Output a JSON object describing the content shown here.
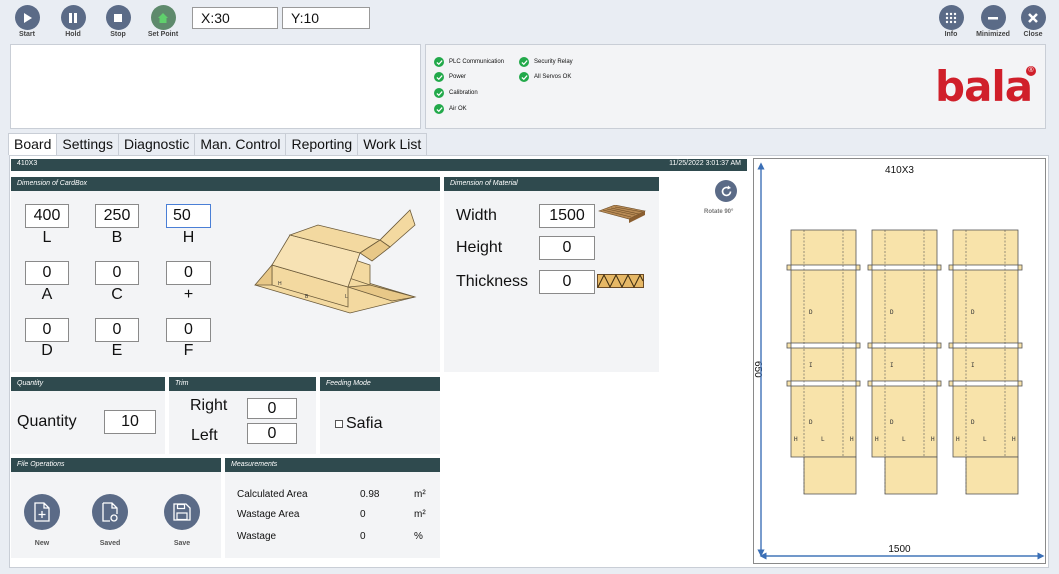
{
  "toolbar": {
    "start": "Start",
    "hold": "Hold",
    "stop": "Stop",
    "set_point": "Set Point",
    "x_coord": "X:30",
    "y_coord": "Y:10",
    "info": "Info",
    "minimized": "Minimized",
    "close": "Close"
  },
  "status": {
    "plc": "PLC Communication",
    "power": "Power",
    "calibration": "Calibration",
    "air": "Air OK",
    "security": "Security Relay",
    "servos": "All Servos OK"
  },
  "logo": {
    "text": "bala",
    "reg": "®"
  },
  "tabs": [
    "Board",
    "Settings",
    "Diagnostic",
    "Man. Control",
    "Reporting",
    "Work List"
  ],
  "board": {
    "name": "410X3",
    "datetime": "11/25/2022 3:01:37 AM",
    "cardbox_header": "Dimension of CardBox",
    "material_header": "Dimension of Material",
    "fields": {
      "L": "400",
      "B": "250",
      "H": "50",
      "A": "0",
      "C": "0",
      "plus": "0",
      "D": "0",
      "E": "0",
      "F": "0"
    },
    "labels": {
      "L": "L",
      "B": "B",
      "H": "H",
      "A": "A",
      "C": "C",
      "plus": "+",
      "D": "D",
      "E": "E",
      "F": "F"
    },
    "box_letters": {
      "h": "H",
      "b": "B",
      "l": "L"
    },
    "material": {
      "width_label": "Width",
      "width": "1500",
      "height_label": "Height",
      "height": "0",
      "thickness_label": "Thickness",
      "thickness": "0"
    },
    "rotate_label": "Rotate 90°",
    "quantity_header": "Quantity",
    "quantity_label": "Quantity",
    "quantity": "10",
    "trim_header": "Trim",
    "right_label": "Right",
    "right": "0",
    "left_label": "Left",
    "left": "0",
    "feeding_header": "Feeding Mode",
    "safia": "Safia",
    "file_header": "File Operations",
    "new": "New",
    "saved": "Saved",
    "save": "Save",
    "meas_header": "Measurements",
    "measurements": [
      {
        "label": "Calculated Area",
        "value": "0.98",
        "unit": "m²"
      },
      {
        "label": "Wastage Area",
        "value": "0",
        "unit": "m²"
      },
      {
        "label": "Wastage",
        "value": "0",
        "unit": "%"
      }
    ]
  },
  "preview": {
    "title": "410X3",
    "height_dim": "650",
    "width_dim": "1500",
    "letters": {
      "d": "D",
      "i": "I",
      "h": "H",
      "l": "L"
    }
  },
  "colors": {
    "header": "#2f4a4e",
    "button": "#5b6b87",
    "ok": "#22a94a",
    "brand": "#d01f2a",
    "cardboard": "#f8e3aa"
  }
}
